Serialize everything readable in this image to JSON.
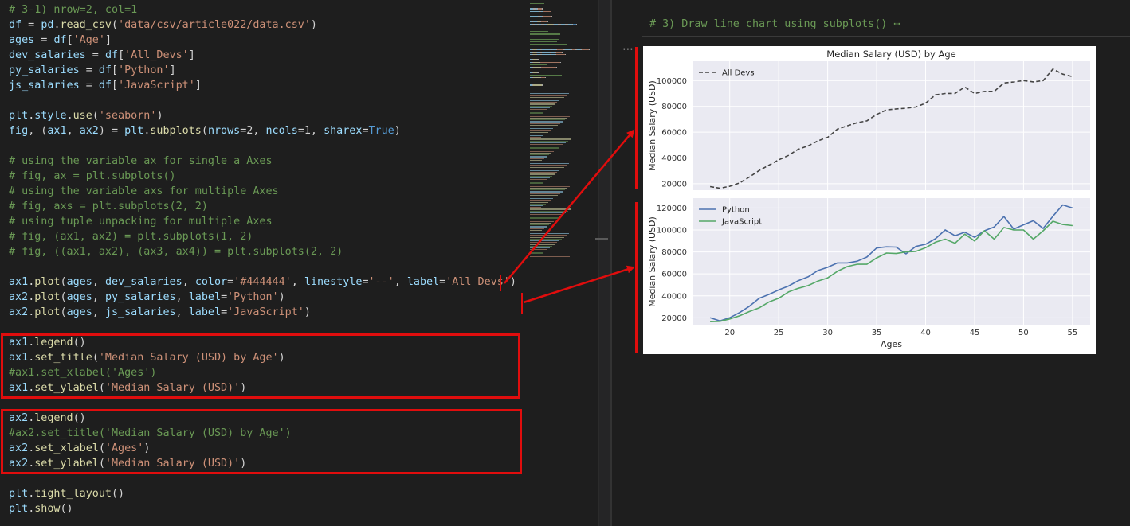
{
  "editor": {
    "lines": [
      [
        [
          "cm",
          "# 3-1) nrow=2, col=1"
        ]
      ],
      [
        [
          "pa",
          "df"
        ],
        [
          "op",
          " = "
        ],
        [
          "pa",
          "pd"
        ],
        [
          "op",
          "."
        ],
        [
          "fn",
          "read_csv"
        ],
        [
          "op",
          "("
        ],
        [
          "st",
          "'data/csv/article022/data.csv'"
        ],
        [
          "op",
          ")"
        ]
      ],
      [
        [
          "pa",
          "ages"
        ],
        [
          "op",
          " = "
        ],
        [
          "pa",
          "df"
        ],
        [
          "op",
          "["
        ],
        [
          "st",
          "'Age'"
        ],
        [
          "op",
          "]"
        ]
      ],
      [
        [
          "pa",
          "dev_salaries"
        ],
        [
          "op",
          " = "
        ],
        [
          "pa",
          "df"
        ],
        [
          "op",
          "["
        ],
        [
          "st",
          "'All_Devs'"
        ],
        [
          "op",
          "]"
        ]
      ],
      [
        [
          "pa",
          "py_salaries"
        ],
        [
          "op",
          " = "
        ],
        [
          "pa",
          "df"
        ],
        [
          "op",
          "["
        ],
        [
          "st",
          "'Python'"
        ],
        [
          "op",
          "]"
        ]
      ],
      [
        [
          "pa",
          "js_salaries"
        ],
        [
          "op",
          " = "
        ],
        [
          "pa",
          "df"
        ],
        [
          "op",
          "["
        ],
        [
          "st",
          "'JavaScript'"
        ],
        [
          "op",
          "]"
        ]
      ],
      [],
      [
        [
          "pa",
          "plt"
        ],
        [
          "op",
          "."
        ],
        [
          "pa",
          "style"
        ],
        [
          "op",
          "."
        ],
        [
          "fn",
          "use"
        ],
        [
          "op",
          "("
        ],
        [
          "st",
          "'seaborn'"
        ],
        [
          "op",
          ")"
        ]
      ],
      [
        [
          "pa",
          "fig"
        ],
        [
          "op",
          ", ("
        ],
        [
          "pa",
          "ax1"
        ],
        [
          "op",
          ", "
        ],
        [
          "pa",
          "ax2"
        ],
        [
          "op",
          ") = "
        ],
        [
          "pa",
          "plt"
        ],
        [
          "op",
          "."
        ],
        [
          "fn",
          "subplots"
        ],
        [
          "op",
          "("
        ],
        [
          "pa",
          "nrows"
        ],
        [
          "op",
          "=2, "
        ],
        [
          "pa",
          "ncols"
        ],
        [
          "op",
          "=1, "
        ],
        [
          "pa",
          "sharex"
        ],
        [
          "op",
          "="
        ],
        [
          "kw",
          "True"
        ],
        [
          "op",
          ")"
        ]
      ],
      [],
      [
        [
          "cm",
          "# using the variable ax for single a Axes"
        ]
      ],
      [
        [
          "cm",
          "# fig, ax = plt.subplots()"
        ]
      ],
      [
        [
          "cm",
          "# using the variable axs for multiple Axes"
        ]
      ],
      [
        [
          "cm",
          "# fig, axs = plt.subplots(2, 2)"
        ]
      ],
      [
        [
          "cm",
          "# using tuple unpacking for multiple Axes"
        ]
      ],
      [
        [
          "cm",
          "# fig, (ax1, ax2) = plt.subplots(1, 2)"
        ]
      ],
      [
        [
          "cm",
          "# fig, ((ax1, ax2), (ax3, ax4)) = plt.subplots(2, 2)"
        ]
      ],
      [],
      [
        [
          "pa",
          "ax1"
        ],
        [
          "op",
          "."
        ],
        [
          "fn",
          "plot"
        ],
        [
          "op",
          "("
        ],
        [
          "pa",
          "ages"
        ],
        [
          "op",
          ", "
        ],
        [
          "pa",
          "dev_salaries"
        ],
        [
          "op",
          ", "
        ],
        [
          "pa",
          "color"
        ],
        [
          "op",
          "="
        ],
        [
          "st",
          "'#444444'"
        ],
        [
          "op",
          ", "
        ],
        [
          "pa",
          "linestyle"
        ],
        [
          "op",
          "="
        ],
        [
          "st",
          "'--'"
        ],
        [
          "op",
          ", "
        ],
        [
          "pa",
          "label"
        ],
        [
          "op",
          "="
        ],
        [
          "st",
          "'All Devs'"
        ],
        [
          "op",
          ")"
        ]
      ],
      [
        [
          "pa",
          "ax2"
        ],
        [
          "op",
          "."
        ],
        [
          "fn",
          "plot"
        ],
        [
          "op",
          "("
        ],
        [
          "pa",
          "ages"
        ],
        [
          "op",
          ", "
        ],
        [
          "pa",
          "py_salaries"
        ],
        [
          "op",
          ", "
        ],
        [
          "pa",
          "label"
        ],
        [
          "op",
          "="
        ],
        [
          "st",
          "'Python'"
        ],
        [
          "op",
          ")"
        ]
      ],
      [
        [
          "pa",
          "ax2"
        ],
        [
          "op",
          "."
        ],
        [
          "fn",
          "plot"
        ],
        [
          "op",
          "("
        ],
        [
          "pa",
          "ages"
        ],
        [
          "op",
          ", "
        ],
        [
          "pa",
          "js_salaries"
        ],
        [
          "op",
          ", "
        ],
        [
          "pa",
          "label"
        ],
        [
          "op",
          "="
        ],
        [
          "st",
          "'JavaScript'"
        ],
        [
          "op",
          ")"
        ]
      ],
      [],
      [
        [
          "pa",
          "ax1"
        ],
        [
          "op",
          "."
        ],
        [
          "fn",
          "legend"
        ],
        [
          "op",
          "()"
        ]
      ],
      [
        [
          "pa",
          "ax1"
        ],
        [
          "op",
          "."
        ],
        [
          "fn",
          "set_title"
        ],
        [
          "op",
          "("
        ],
        [
          "st",
          "'Median Salary (USD) by Age'"
        ],
        [
          "op",
          ")"
        ]
      ],
      [
        [
          "cm",
          "#ax1.set_xlabel('Ages')"
        ]
      ],
      [
        [
          "pa",
          "ax1"
        ],
        [
          "op",
          "."
        ],
        [
          "fn",
          "set_ylabel"
        ],
        [
          "op",
          "("
        ],
        [
          "st",
          "'Median Salary (USD)'"
        ],
        [
          "op",
          ")"
        ]
      ],
      [],
      [
        [
          "pa",
          "ax2"
        ],
        [
          "op",
          "."
        ],
        [
          "fn",
          "legend"
        ],
        [
          "op",
          "()"
        ]
      ],
      [
        [
          "cm",
          "#ax2.set_title('Median Salary (USD) by Age')"
        ]
      ],
      [
        [
          "pa",
          "ax2"
        ],
        [
          "op",
          "."
        ],
        [
          "fn",
          "set_xlabel"
        ],
        [
          "op",
          "("
        ],
        [
          "st",
          "'Ages'"
        ],
        [
          "op",
          ")"
        ]
      ],
      [
        [
          "pa",
          "ax2"
        ],
        [
          "op",
          "."
        ],
        [
          "fn",
          "set_ylabel"
        ],
        [
          "op",
          "("
        ],
        [
          "st",
          "'Median Salary (USD)'"
        ],
        [
          "op",
          ")"
        ]
      ],
      [],
      [
        [
          "pa",
          "plt"
        ],
        [
          "op",
          "."
        ],
        [
          "fn",
          "tight_layout"
        ],
        [
          "op",
          "()"
        ]
      ],
      [
        [
          "pa",
          "plt"
        ],
        [
          "op",
          "."
        ],
        [
          "fn",
          "show"
        ],
        [
          "op",
          "()"
        ]
      ]
    ]
  },
  "output": {
    "cell_comment": "# 3) Draw line chart using subplots() ⋯",
    "ellipsis": "⋯"
  },
  "colors": {
    "annotation_red": "#e00d0d",
    "plot_bg": "#eaeaf2",
    "all_devs": "#444444",
    "python": "#4c72b0",
    "javascript": "#55a868"
  },
  "chart_data": [
    {
      "type": "line",
      "title": "Median Salary (USD) by Age",
      "xlabel": "",
      "ylabel": "Median Salary (USD)",
      "ylim": [
        15000,
        115000
      ],
      "xlim": [
        16.2,
        56.8
      ],
      "yticks": [
        20000,
        40000,
        60000,
        80000,
        100000
      ],
      "xticks": [
        20,
        25,
        30,
        35,
        40,
        45,
        50,
        55
      ],
      "grid": true,
      "legend": "upper left",
      "x": [
        18,
        19,
        20,
        21,
        22,
        23,
        24,
        25,
        26,
        27,
        28,
        29,
        30,
        31,
        32,
        33,
        34,
        35,
        36,
        37,
        38,
        39,
        40,
        41,
        42,
        43,
        44,
        45,
        46,
        47,
        48,
        49,
        50,
        51,
        52,
        53,
        54,
        55
      ],
      "series": [
        {
          "name": "All Devs",
          "linestyle": "--",
          "color": "#444444",
          "values": [
            17784,
            16500,
            18012,
            20628,
            25206,
            30252,
            34368,
            38496,
            42000,
            46752,
            49320,
            53200,
            56000,
            62316,
            64928,
            67317,
            68748,
            73752,
            77232,
            78000,
            78508,
            79536,
            82488,
            88935,
            90000,
            90056,
            95000,
            90000,
            91633,
            91660,
            98150,
            98964,
            100000,
            98988,
            100000,
            108923,
            105000,
            103117
          ]
        }
      ]
    },
    {
      "type": "line",
      "title": "",
      "xlabel": "Ages",
      "ylabel": "Median Salary (USD)",
      "ylim": [
        13000,
        129000
      ],
      "xlim": [
        16.2,
        56.8
      ],
      "yticks": [
        20000,
        40000,
        60000,
        80000,
        100000,
        120000
      ],
      "xticks": [
        20,
        25,
        30,
        35,
        40,
        45,
        50,
        55
      ],
      "grid": true,
      "legend": "upper left",
      "x": [
        18,
        19,
        20,
        21,
        22,
        23,
        24,
        25,
        26,
        27,
        28,
        29,
        30,
        31,
        32,
        33,
        34,
        35,
        36,
        37,
        38,
        39,
        40,
        41,
        42,
        43,
        44,
        45,
        46,
        47,
        48,
        49,
        50,
        51,
        52,
        53,
        54,
        55
      ],
      "series": [
        {
          "name": "Python",
          "color": "#4c72b0",
          "values": [
            20046,
            17100,
            20000,
            24744,
            30500,
            37732,
            41247,
            45372,
            48876,
            53850,
            57287,
            63016,
            65998,
            70003,
            70000,
            71496,
            75370,
            83640,
            84666,
            84392,
            78254,
            85000,
            87038,
            91991,
            100000,
            94796,
            97962,
            93302,
            99240,
            102736,
            112285,
            100771,
            104708,
            108423,
            101407,
            112542,
            122870,
            120000
          ]
        },
        {
          "name": "JavaScript",
          "color": "#55a868",
          "values": [
            16446,
            16791,
            18942,
            21780,
            25704,
            29000,
            34372,
            37810,
            43515,
            46823,
            49293,
            53437,
            56373,
            62375,
            66674,
            68745,
            68746,
            74583,
            79000,
            78508,
            79996,
            80403,
            83820,
            88833,
            91660,
            87892,
            96243,
            90000,
            99313,
            91660,
            102264,
            100000,
            100000,
            91660,
            99240,
            108000,
            105000,
            104000
          ]
        }
      ]
    }
  ]
}
